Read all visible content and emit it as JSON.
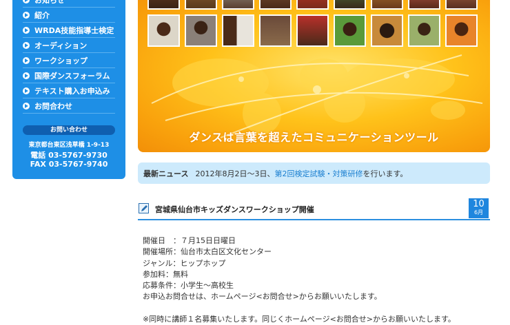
{
  "sidebar": {
    "menu": [
      {
        "label": "お知らせ"
      },
      {
        "label": "紹介"
      },
      {
        "label": "WRDA技能指導士検定"
      },
      {
        "label": "オーディション"
      },
      {
        "label": "ワークショップ"
      },
      {
        "label": "国際ダンスフォーラム"
      },
      {
        "label": "テキスト購入お申込み"
      },
      {
        "label": "お問合わせ"
      }
    ],
    "contact": {
      "title": "お問い合わせ",
      "address": "東京都台東区浅草橋 1-9-13",
      "tel": "電話 03-5767-9730",
      "fax": "FAX 03-5767-9740"
    }
  },
  "banner": {
    "slogan": "ダンスは言葉を超えたコミュニケーションツール"
  },
  "news": {
    "label": "最新ニュース",
    "text_before": "2012年8月2日〜3日、",
    "link": "第2回検定試験・対策研修",
    "text_after": "を行います。"
  },
  "article": {
    "title": "宮城県仙台市キッズダンスワークショップ開催",
    "date_day": "10",
    "date_month": "6月",
    "lines": [
      "開催日　：７月15日日曜日",
      "開催場所：仙台市太白区文化センター",
      "ジャンル：ヒップホップ",
      "参加料：無料",
      "応募条件：小学生〜高校生",
      "お申込お問合せは、ホームページ<お問合せ>からお願いいたします。"
    ],
    "extra_line": "※同時に講師１名募集いたします。同じくホームページ<お問合せ>からお願いいたします。"
  },
  "colors": {
    "sidebar_blue": "#1e8fe6",
    "banner_orange": "#f9a10c",
    "news_bg": "#cdeafc",
    "link_blue": "#1a7fd0"
  }
}
